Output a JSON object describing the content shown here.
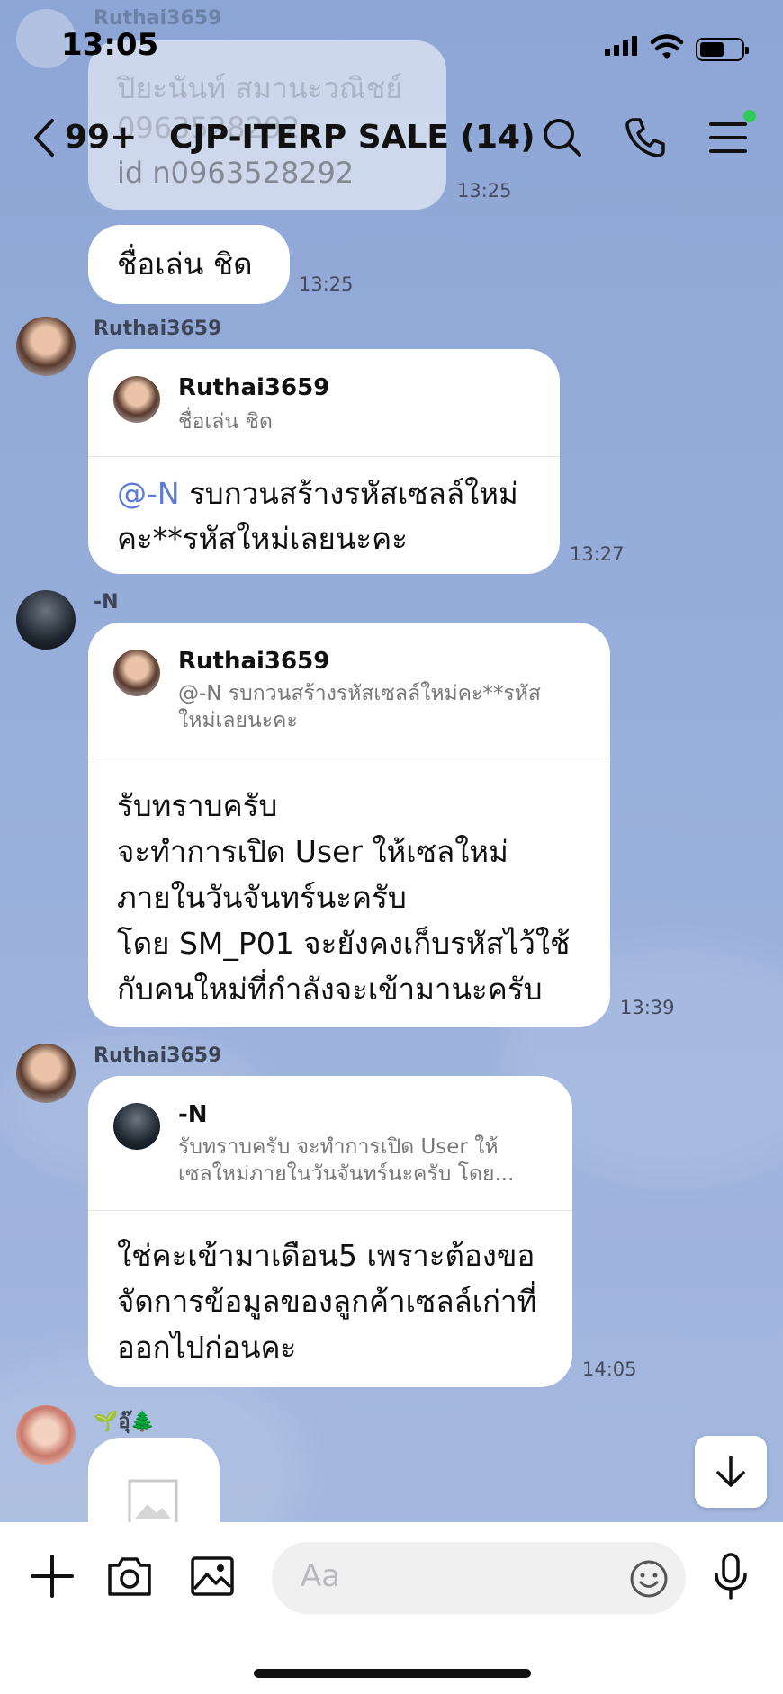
{
  "status_bar": {
    "time": "13:05"
  },
  "header": {
    "back_count": "99+",
    "title": "CJP-ITERP SALE (14)"
  },
  "ghost": {
    "sender": "Ruthai3659",
    "line1": "ปิยะนันท์  สมานะวณิชย์",
    "line2": "0963528292",
    "line3": "id n0963528292",
    "time": "13:25"
  },
  "messages": [
    {
      "text": "ชื่อเล่น  ชิด",
      "time": "13:25"
    },
    {
      "sender": "Ruthai3659",
      "reply_name": "Ruthai3659",
      "reply_text": "ชื่อเล่น ชิด",
      "mention": "@-N",
      "line1": " รบกวนสร้างรหัสเซลล์ใหม่",
      "line2": "คะ**รหัสใหม่เลยนะคะ",
      "time": "13:27"
    },
    {
      "sender": "-N",
      "reply_name": "Ruthai3659",
      "reply_line1": "@-N รบกวนสร้างรหัสเซลล์ใหม่คะ**รหัส",
      "reply_line2": "ใหม่เลยนะคะ",
      "lines": [
        "รับทราบครับ",
        "จะทำการเปิด User ให้เซลใหม่",
        "ภายในวันจันทร์นะครับ",
        "โดย SM_P01 จะยังคงเก็บรหัสไว้ใช้",
        "กับคนใหม่ที่กำลังจะเข้ามานะครับ"
      ],
      "time": "13:39"
    },
    {
      "sender": "Ruthai3659",
      "reply_name": "-N",
      "reply_line1": "รับทราบครับ จะทำการเปิด User ให้",
      "reply_line2": "เซลใหม่ภายในวันจันทร์นะครับ โดย...",
      "lines": [
        "ใช่คะเข้ามาเดือน5 เพราะต้องขอ",
        "จัดการข้อมูลของลูกค้าเซลล์เก่าที่",
        "ออกไปก่อนคะ"
      ],
      "time": "14:05"
    },
    {
      "sender": "🌱อุ๊🌲"
    }
  ],
  "input": {
    "placeholder": "Aa"
  },
  "icons": [
    "back-icon",
    "search-icon",
    "phone-icon",
    "menu-icon",
    "plus-icon",
    "camera-icon",
    "image-icon",
    "emoji-icon",
    "mic-icon",
    "scroll-down-icon"
  ]
}
